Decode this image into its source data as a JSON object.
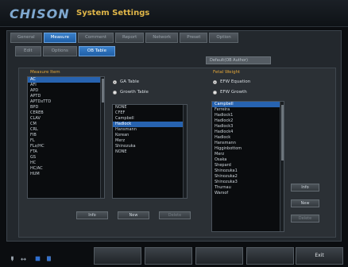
{
  "header": {
    "logo": "CHISON",
    "title": "System Settings"
  },
  "tabs": [
    "General",
    "Measure",
    "Comment",
    "Report",
    "Network",
    "Preset",
    "Option"
  ],
  "active_tab": 1,
  "subtabs": [
    "Edit",
    "Options",
    "OB Table"
  ],
  "active_subtab": 2,
  "combo_value": "Default(OB Author)",
  "measure_item_label": "Measure Item",
  "measure_items": [
    "AC",
    "AFI",
    "APD",
    "APTD",
    "APTDxTTD",
    "BPD",
    "CEREB",
    "CLAV",
    "CM",
    "CRL",
    "FIB",
    "FL",
    "FLx/HC",
    "FTA",
    "GS",
    "HC",
    "HC/AC",
    "HUM"
  ],
  "measure_selected": 0,
  "radio_ga": "GA Table",
  "radio_growth": "Growth Table",
  "authors": [
    "NONE",
    "CFEF",
    "Campbell",
    "Hadlock",
    "Hansmann",
    "Korean",
    "Merz",
    "Shinozuka",
    "NONE"
  ],
  "authors_selected": 3,
  "fetal_weight_label": "Fetal Weight",
  "radio_efw_eq": "EFW Equation",
  "radio_efw_growth": "EFW Growth",
  "efw_list": [
    "Campbell",
    "Ferreira",
    "Hadlock1",
    "Hadlock2",
    "Hadlock3",
    "Hadlock4",
    "Hadlock",
    "Hansmann",
    "Higginbottom",
    "Merz",
    "Osaka",
    "Shepard",
    "Shinozuka1",
    "Shinozuka2",
    "Shinozuka3",
    "Thurnau",
    "Warsof"
  ],
  "efw_selected": 0,
  "buttons_left": {
    "info": "Info",
    "new": "New",
    "delete": "Delete"
  },
  "buttons_right": {
    "info": "Info",
    "new": "New",
    "delete": "Delete"
  },
  "exit_label": "Exit"
}
